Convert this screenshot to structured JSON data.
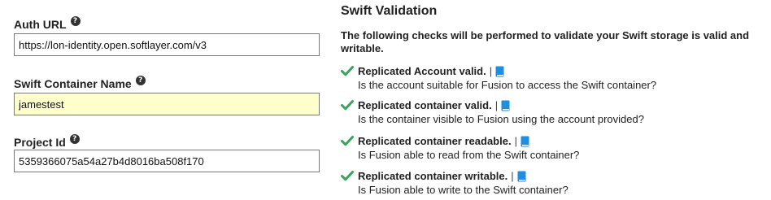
{
  "form": {
    "auth_url": {
      "label": "Auth URL",
      "value": "https://lon-identity.open.softlayer.com/v3"
    },
    "container_name": {
      "label": "Swift Container Name",
      "value": "jamestest"
    },
    "project_id": {
      "label": "Project Id",
      "value": "5359366075a54a27b4d8016ba508f170"
    },
    "help_glyph": "?"
  },
  "validation": {
    "title": "Swift Validation",
    "description": "The following checks will be performed to validate your Swift storage is valid and writable.",
    "separator": "|",
    "check_color": "#3aa55a",
    "doc_icon_color": "#1f8ee0",
    "checks": [
      {
        "title": "Replicated Account valid.",
        "description": "Is the account suitable for Fusion to access the Swift container?"
      },
      {
        "title": "Replicated container valid.",
        "description": "Is the container visible to Fusion using the account provided?"
      },
      {
        "title": "Replicated container readable.",
        "description": "Is Fusion able to read from the Swift container?"
      },
      {
        "title": "Replicated container writable.",
        "description": "Is Fusion able to write to the Swift container?"
      }
    ]
  }
}
